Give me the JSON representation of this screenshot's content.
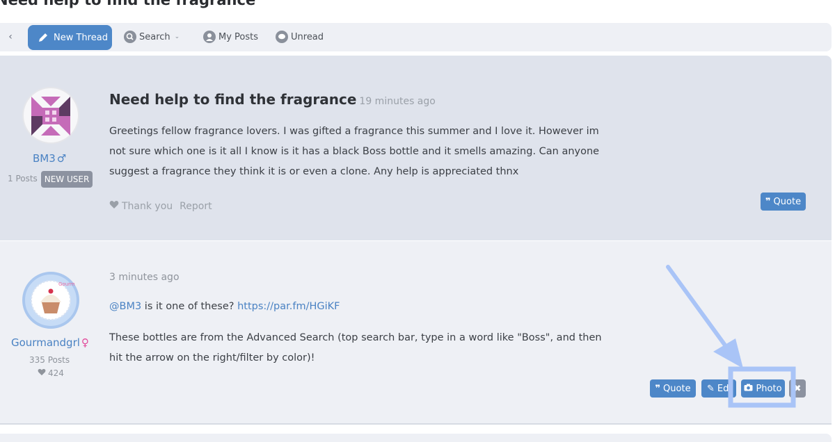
{
  "page": {
    "title": "Need help to find the fragrance"
  },
  "toolbar": {
    "back_label": "‹",
    "new_thread_label": "New Thread",
    "search_label": "Search",
    "my_posts_label": "My Posts",
    "unread_label": "Unread"
  },
  "posts": [
    {
      "username": "BM3",
      "gender_symbol": "♂",
      "post_count": "1 Posts",
      "badge": "NEW USER",
      "title": "Need help to find the fragrance",
      "time": "19 minutes ago",
      "body": "Greetings fellow fragrance lovers. I was gifted a fragrance this summer and I love it. However im not sure which one is it all I know is it has a black Boss bottle and it smells amazing. Can anyone suggest a fragrance they think it is or even a clone. Any help is appreciated thnx",
      "thank_you_label": "Thank you",
      "report_label": "Report",
      "quote_label": "Quote"
    },
    {
      "username": "Gourmandgrl",
      "gender_symbol": "♀",
      "post_count": "335 Posts",
      "likes": "424",
      "time": "3 minutes ago",
      "mention": "@BM3",
      "line1_text": " is it one of these? ",
      "link": "https://par.fm/HGiKF",
      "body2": "These bottles are from the Advanced Search (top search bar, type in a word like \"Boss\", and then hit the arrow on the right/filter by color)!",
      "quote_label": "Quote",
      "edit_label": "Edi",
      "photo_label": "Photo",
      "delete_label": "✖"
    }
  ],
  "colors": {
    "accent": "#4d87c8",
    "annotation": "#a9c4f7"
  }
}
